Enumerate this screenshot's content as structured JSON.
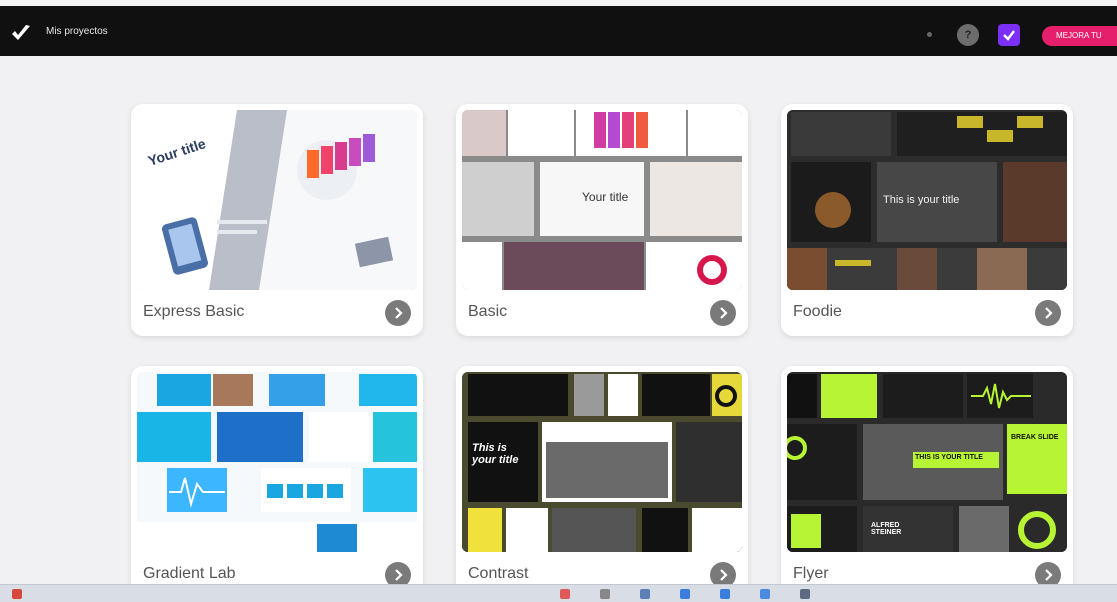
{
  "header": {
    "brand": "Mis proyectos",
    "help": "?",
    "upgrade_label": "MEJORA TU",
    "colors": {
      "bar": "#101010",
      "upgrade": "#e51f6c",
      "badge": "#7b2ff7"
    }
  },
  "templates": [
    {
      "name": "Express Basic",
      "thumb": {
        "title": "Your title"
      }
    },
    {
      "name": "Basic",
      "thumb": {
        "title": "Your title"
      }
    },
    {
      "name": "Foodie",
      "thumb": {
        "title": "This is your title"
      }
    },
    {
      "name": "Gradient Lab"
    },
    {
      "name": "Contrast",
      "thumb": {
        "title": "This is your title"
      }
    },
    {
      "name": "Flyer",
      "thumb": {
        "title": "THIS IS YOUR TITLE",
        "slide": "BREAK SLIDE",
        "person": "ALFRED STEINER"
      }
    }
  ]
}
